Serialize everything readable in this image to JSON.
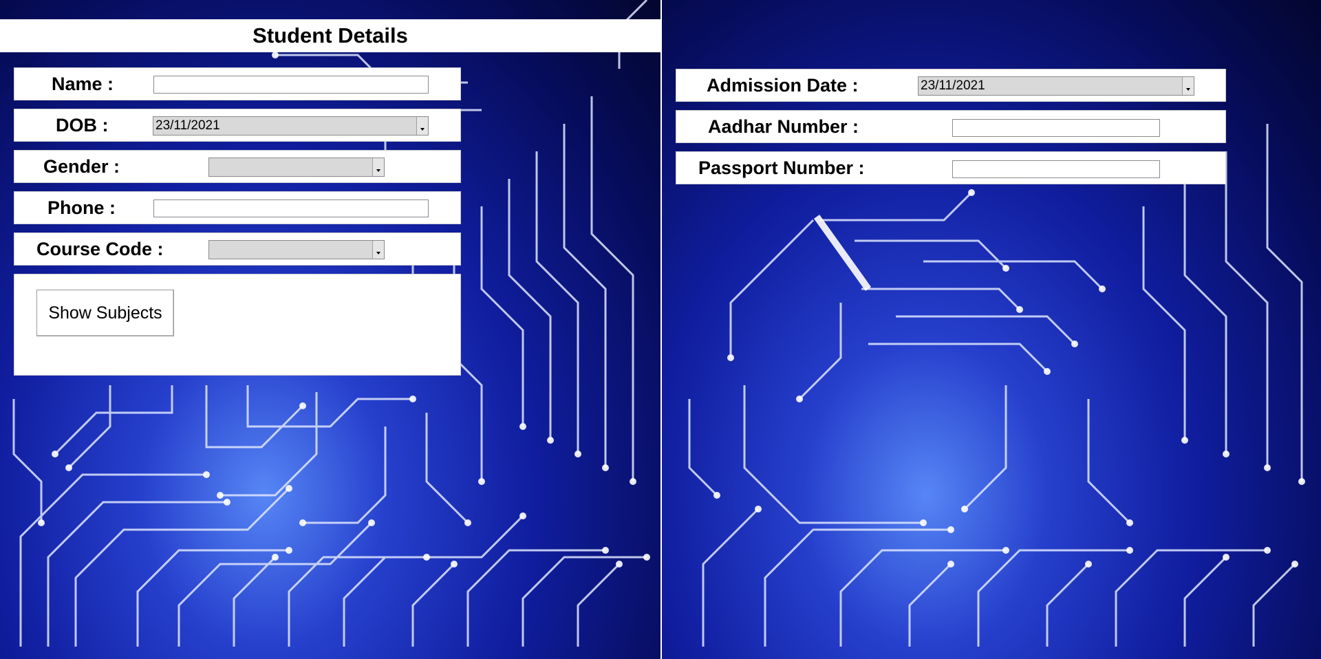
{
  "colors": {
    "background_deep": "#03062e",
    "background_glow": "#2846e6",
    "circuit_trace": "#dfe6ff",
    "panel": "#ffffff",
    "combo_fill": "#d9d9d9"
  },
  "left": {
    "title": "Student Details",
    "fields": {
      "name": {
        "label": "Name :",
        "value": ""
      },
      "dob": {
        "label": "DOB :",
        "value": "23/11/2021"
      },
      "gender": {
        "label": "Gender :",
        "value": ""
      },
      "phone": {
        "label": "Phone :",
        "value": ""
      },
      "course_code": {
        "label": "Course Code :",
        "value": ""
      }
    },
    "show_subjects_button": "Show Subjects"
  },
  "right": {
    "fields": {
      "admission_date": {
        "label": "Admission Date :",
        "value": "23/11/2021"
      },
      "aadhar_number": {
        "label": "Aadhar Number :",
        "value": ""
      },
      "passport_number": {
        "label": "Passport Number :",
        "value": ""
      }
    }
  }
}
